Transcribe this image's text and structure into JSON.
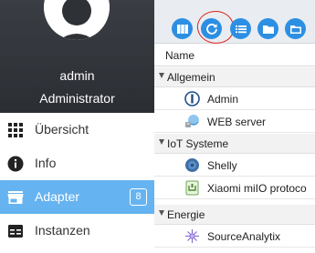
{
  "user": {
    "name": "admin",
    "role": "Administrator"
  },
  "nav": {
    "items": [
      {
        "label": "Übersicht",
        "icon": "grid-icon"
      },
      {
        "label": "Info",
        "icon": "info-icon"
      },
      {
        "label": "Adapter",
        "icon": "store-icon",
        "badge": "8",
        "active": true
      },
      {
        "label": "Instanzen",
        "icon": "instances-icon"
      }
    ]
  },
  "toolbar": {
    "buttons": [
      "view-tiles-icon",
      "refresh-icon",
      "list-icon",
      "folder-icon",
      "folder-open-icon"
    ]
  },
  "table": {
    "column_name": "Name",
    "groups": [
      {
        "label": "Allgemein",
        "items": [
          {
            "label": "Admin",
            "icon": "admin-adapter-icon"
          },
          {
            "label": "WEB server",
            "icon": "web-adapter-icon"
          }
        ]
      },
      {
        "label": "IoT Systeme",
        "items": [
          {
            "label": "Shelly",
            "icon": "shelly-adapter-icon"
          },
          {
            "label": "Xiaomi miIO protoco",
            "icon": "xiaomi-adapter-icon"
          }
        ]
      },
      {
        "label": "Energie",
        "items": [
          {
            "label": "SourceAnalytix",
            "icon": "sourceanalytix-adapter-icon"
          }
        ]
      }
    ]
  },
  "colors": {
    "sidebar_header": "#2e3136",
    "active_nav": "#65b3f0",
    "toolbar_button": "#2c8fe3",
    "highlight": "#e0201c"
  }
}
